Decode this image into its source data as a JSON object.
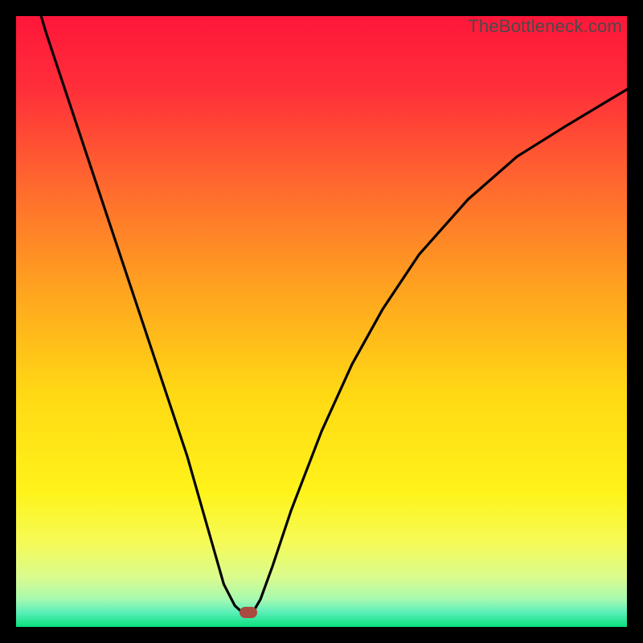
{
  "watermark": "TheBottleneck.com",
  "frame": {
    "outer_size_px": 800,
    "border_px": 20,
    "border_color": "#000000",
    "inner_size_px": 760
  },
  "gradient": {
    "type": "vertical_linear",
    "stops": [
      {
        "offset": 0.0,
        "color": "#ff163a"
      },
      {
        "offset": 0.12,
        "color": "#ff2f3a"
      },
      {
        "offset": 0.28,
        "color": "#ff6a2e"
      },
      {
        "offset": 0.45,
        "color": "#ffa41f"
      },
      {
        "offset": 0.62,
        "color": "#ffd914"
      },
      {
        "offset": 0.78,
        "color": "#fff31a"
      },
      {
        "offset": 0.86,
        "color": "#f6fb56"
      },
      {
        "offset": 0.92,
        "color": "#d9fb8f"
      },
      {
        "offset": 0.955,
        "color": "#a6f9b0"
      },
      {
        "offset": 0.975,
        "color": "#5ef0ba"
      },
      {
        "offset": 1.0,
        "color": "#09e07e"
      }
    ]
  },
  "curve": {
    "stroke": "#000000",
    "stroke_width_px": 3.2
  },
  "marker": {
    "x_frac": 0.3803,
    "y_frac": 0.9766,
    "color": "#ab4a3e"
  },
  "chart_data": {
    "type": "line",
    "title": "",
    "xlabel": "",
    "ylabel": "",
    "xlim": [
      0,
      100
    ],
    "ylim": [
      0,
      100
    ],
    "grid": false,
    "legend": false,
    "annotations": [
      "TheBottleneck.com"
    ],
    "note": "Axes are unlabeled; x/y expressed as 0–100 percent of the plotting area (origin at bottom-left). Values are estimated from pixel positions.",
    "series": [
      {
        "name": "bottleneck_curve",
        "x": [
          0,
          2,
          5,
          8,
          12,
          16,
          20,
          24,
          28,
          32,
          34,
          35.8,
          37,
          38,
          39,
          40,
          42,
          45,
          50,
          55,
          60,
          66,
          74,
          82,
          90,
          100
        ],
        "y": [
          114,
          107,
          97,
          88,
          76,
          64,
          52,
          40,
          28,
          14,
          7,
          3.5,
          2.4,
          2.3,
          2.8,
          4.5,
          10,
          19,
          32,
          43,
          52,
          61,
          70,
          77,
          82,
          88
        ]
      },
      {
        "name": "marker",
        "type": "scatter",
        "x": [
          38.0
        ],
        "y": [
          2.3
        ],
        "color": "#ab4a3e"
      }
    ],
    "minimum": {
      "x": 38.0,
      "y": 2.3
    }
  }
}
